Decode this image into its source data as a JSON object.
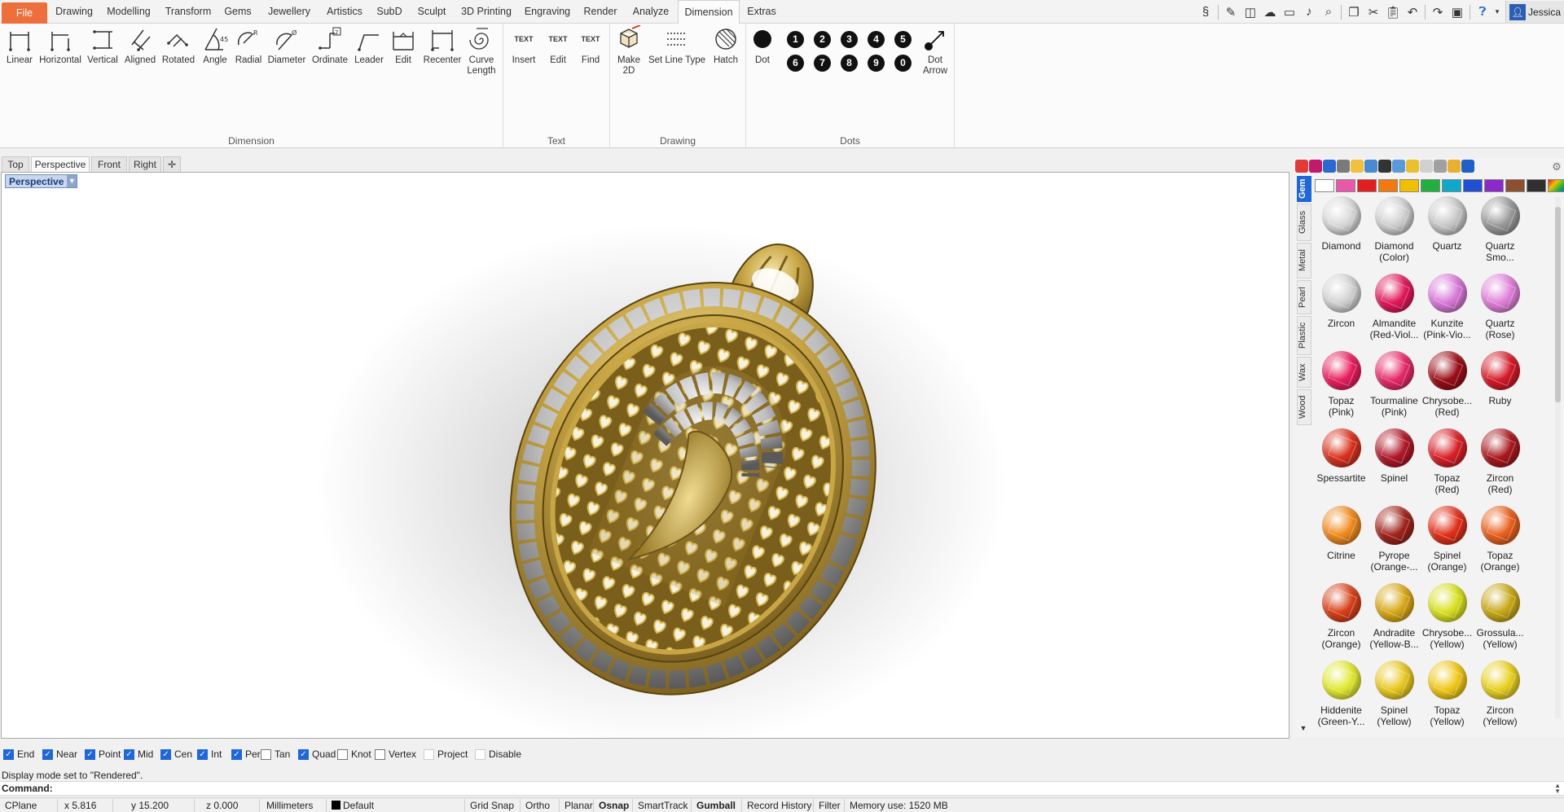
{
  "menu": {
    "tabs": [
      "File",
      "Drawing",
      "Modelling",
      "Transform",
      "Gems",
      "Jewellery",
      "Artistics",
      "SubD",
      "Sculpt",
      "3D Printing",
      "Engraving",
      "Render",
      "Analyze",
      "Dimension",
      "Extras"
    ],
    "active": "Dimension",
    "user": "Jessica"
  },
  "qat_icons": [
    "curve-tools-icon",
    "pen-icon",
    "scan-icon",
    "cloud-icon",
    "video-icon",
    "microphone-icon",
    "zoom-icon",
    "copy-icon",
    "cut-icon",
    "paste-icon",
    "undo-icon",
    "redo-icon",
    "save-icon",
    "help-icon"
  ],
  "ribbon": {
    "groups": [
      {
        "name": "Dimension",
        "buttons": [
          "Linear",
          "Horizontal",
          "Vertical",
          "Aligned",
          "Rotated",
          "Angle",
          "Radial",
          "Diameter",
          "Ordinate",
          "Leader",
          "Edit",
          "Recenter",
          "Curve Length"
        ]
      },
      {
        "name": "Text",
        "buttons": [
          "Insert",
          "Edit",
          "Find"
        ]
      },
      {
        "name": "Drawing",
        "buttons": [
          "Make 2D",
          "Set Line Type",
          "Hatch"
        ]
      },
      {
        "name": "Dots",
        "buttons": [
          "Dot",
          "Dot Arrow"
        ],
        "numbers": [
          "1",
          "2",
          "3",
          "4",
          "5",
          "6",
          "7",
          "8",
          "9",
          "0"
        ]
      }
    ],
    "text_icon_label": "TEXT"
  },
  "viewports": {
    "tabs": [
      "Top",
      "Perspective",
      "Front",
      "Right"
    ],
    "active": "Perspective",
    "label": "Perspective"
  },
  "panel": {
    "vertical_tabs": [
      "Gem",
      "Glass",
      "Metal",
      "Pearl",
      "Plastic",
      "Wax",
      "Wood"
    ],
    "active_tab": "Gem",
    "swatch_colors": [
      "#ffffff",
      "#e85aa8",
      "#e02020",
      "#f07a10",
      "#f0c000",
      "#20b040",
      "#10a8c8",
      "#2050d0",
      "#8a2ac8",
      "#8a5030",
      "#303030"
    ],
    "gems": [
      {
        "name": "Diamond",
        "color": "#d8d8d8"
      },
      {
        "name": "Diamond (Color)",
        "color": "#cfcfcf"
      },
      {
        "name": "Quartz",
        "color": "#c8c8c8"
      },
      {
        "name": "Quartz Smo...",
        "color": "#9a9a9a"
      },
      {
        "name": "Zircon",
        "color": "#d2d2d2"
      },
      {
        "name": "Almandite (Red-Viol...",
        "color": "#e0185a"
      },
      {
        "name": "Kunzite (Pink-Vio...",
        "color": "#d878d8"
      },
      {
        "name": "Quartz (Rose)",
        "color": "#e080d8"
      },
      {
        "name": "Topaz (Pink)",
        "color": "#e81e5e"
      },
      {
        "name": "Tourmaline (Pink)",
        "color": "#e62a6a"
      },
      {
        "name": "Chrysobe... (Red)",
        "color": "#9a0e18"
      },
      {
        "name": "Ruby",
        "color": "#d41a28"
      },
      {
        "name": "Spessartite",
        "color": "#d8321e"
      },
      {
        "name": "Spinel",
        "color": "#b01828"
      },
      {
        "name": "Topaz (Red)",
        "color": "#d82028"
      },
      {
        "name": "Zircon (Red)",
        "color": "#a8181e"
      },
      {
        "name": "Citrine",
        "color": "#f08a1e"
      },
      {
        "name": "Pyrope (Orange-...",
        "color": "#a0241c"
      },
      {
        "name": "Spinel (Orange)",
        "color": "#e0301a"
      },
      {
        "name": "Topaz (Orange)",
        "color": "#e8601e"
      },
      {
        "name": "Zircon (Orange)",
        "color": "#d8401a"
      },
      {
        "name": "Andradite (Yellow-B...",
        "color": "#d8a818"
      },
      {
        "name": "Chrysobe... (Yellow)",
        "color": "#d8e020"
      },
      {
        "name": "Grossula... (Yellow)",
        "color": "#c8a818"
      },
      {
        "name": "Hiddenite (Green-Y...",
        "color": "#e0e830"
      },
      {
        "name": "Spinel (Yellow)",
        "color": "#e8c820"
      },
      {
        "name": "Topaz (Yellow)",
        "color": "#f0c818"
      },
      {
        "name": "Zircon (Yellow)",
        "color": "#e8d020"
      }
    ]
  },
  "osnaps": [
    {
      "label": "End",
      "checked": true
    },
    {
      "label": "Near",
      "checked": true
    },
    {
      "label": "Point",
      "checked": true
    },
    {
      "label": "Mid",
      "checked": true
    },
    {
      "label": "Cen",
      "checked": true
    },
    {
      "label": "Int",
      "checked": true
    },
    {
      "label": "Perp",
      "checked": true
    },
    {
      "label": "Tan",
      "checked": false
    },
    {
      "label": "Quad",
      "checked": true
    },
    {
      "label": "Knot",
      "checked": false
    },
    {
      "label": "Vertex",
      "checked": false
    },
    {
      "label": "Project",
      "checked": false
    },
    {
      "label": "Disable",
      "checked": false
    }
  ],
  "command": {
    "history": "Display mode set to \"Rendered\".",
    "label": "Command:",
    "value": ""
  },
  "status": {
    "cplane": "CPlane",
    "x": "x 5.816",
    "y": "y 15.200",
    "z": "z 0.000",
    "units": "Millimeters",
    "layer": "Default",
    "toggles": [
      "Grid Snap",
      "Ortho",
      "Planar",
      "Osnap",
      "SmartTrack",
      "Gumball",
      "Record History",
      "Filter"
    ],
    "bold_toggles": [
      "Osnap",
      "Gumball"
    ],
    "memory": "Memory use: 1520 MB"
  }
}
